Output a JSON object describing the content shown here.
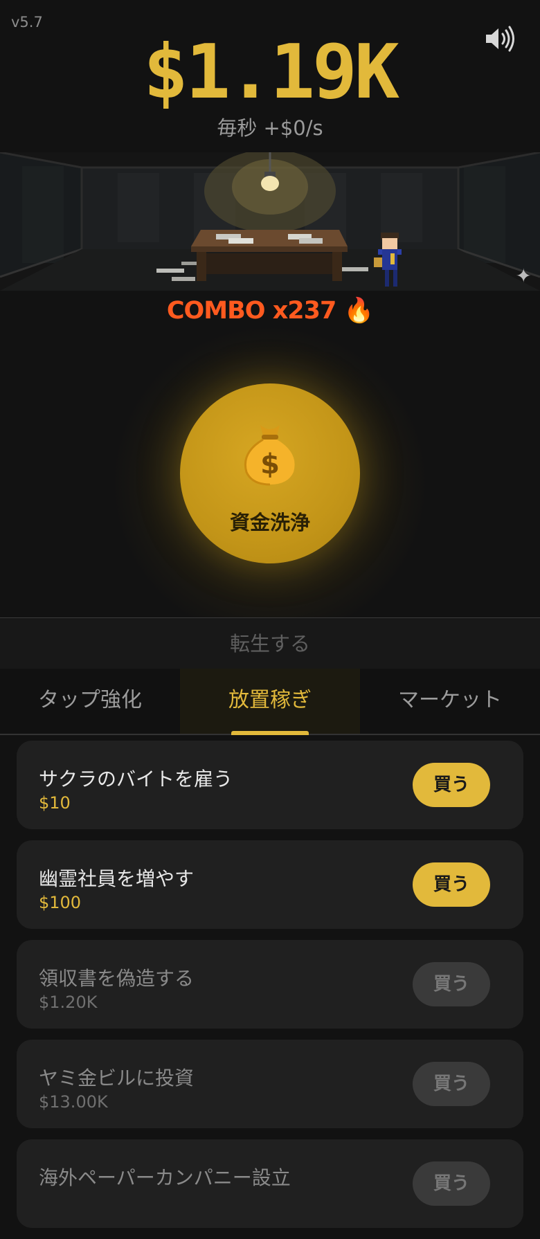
{
  "header": {
    "version": "v5.7",
    "money": "$1.19K",
    "rate": "毎秒 +$0/s",
    "sound_icon": "speaker-icon"
  },
  "combo": {
    "text": "COMBO x237 🔥"
  },
  "tap_button": {
    "icon": "💰",
    "label": "資金洗浄"
  },
  "prestige": {
    "label": "転生する"
  },
  "tabs": [
    {
      "label": "タップ強化"
    },
    {
      "label": "放置稼ぎ"
    },
    {
      "label": "マーケット"
    }
  ],
  "shop": {
    "items": [
      {
        "name": "サクラのバイトを雇う",
        "price": "$10",
        "buy": "買う"
      },
      {
        "name": "幽霊社員を増やす",
        "price": "$100",
        "buy": "買う"
      },
      {
        "name": "領収書を偽造する",
        "price": "$1.20K",
        "buy": "買う"
      },
      {
        "name": "ヤミ金ビルに投資",
        "price": "$13.00K",
        "buy": "買う"
      },
      {
        "name": "海外ペーパーカンパニー設立",
        "price": "",
        "buy": "買う"
      }
    ]
  },
  "colors": {
    "accent": "#e2b93b",
    "combo": "#ff5a1f",
    "background": "#121212"
  }
}
